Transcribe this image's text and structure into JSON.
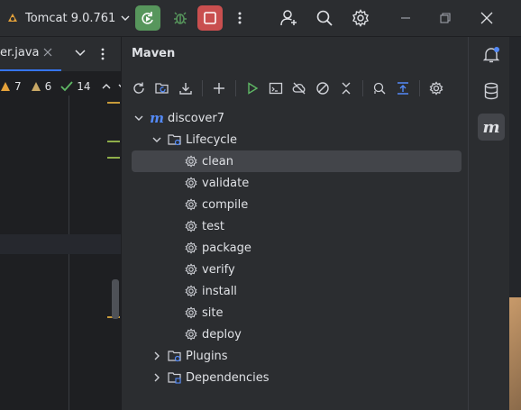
{
  "topbar": {
    "run_config": "Tomcat 9.0.761",
    "run_icon": "rerun-icon",
    "debug_icon": "debug-icon",
    "stop_icon": "stop-icon",
    "more_icon": "more-vertical-icon"
  },
  "editor": {
    "tab_label": "er.java",
    "inspections": {
      "warnings": "7",
      "weak_warnings": "6",
      "ok": "14"
    }
  },
  "maven": {
    "title": "Maven",
    "toolbar": [
      "reload-icon",
      "reload-project-icon",
      "download-icon",
      "add-icon",
      "run-icon",
      "execute-goal-icon",
      "offline-icon",
      "skip-tests-icon",
      "collapse-icon",
      "show-dependencies-icon",
      "expand-all-icon",
      "maven-settings-icon"
    ],
    "project": "discover7",
    "lifecycle_label": "Lifecycle",
    "goals": [
      "clean",
      "validate",
      "compile",
      "test",
      "package",
      "verify",
      "install",
      "site",
      "deploy"
    ],
    "selected_goal": "clean",
    "plugins_label": "Plugins",
    "dependencies_label": "Dependencies"
  },
  "colors": {
    "accent": "#3574f0",
    "run_green": "#57965c",
    "stop_red": "#c94f4f",
    "panel_bg": "#2b2d30",
    "editor_bg": "#1e1f22",
    "selection": "#43454a",
    "maven_blue": "#548af7"
  }
}
